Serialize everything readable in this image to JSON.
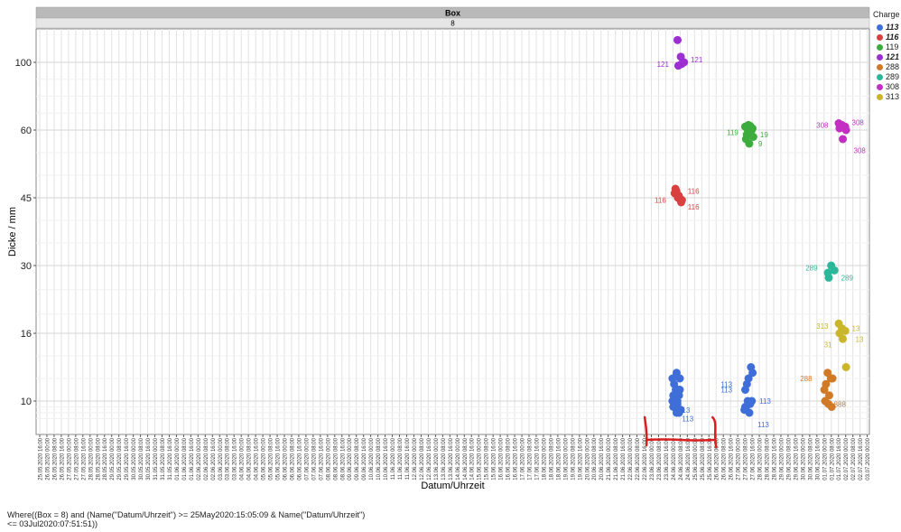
{
  "chart_data": {
    "type": "scatter",
    "panel_title": "Box",
    "panel_subtitle": "8",
    "xlabel": "Datum/Uhrzeit",
    "ylabel": "Dicke / mm",
    "y_tick_labels": [
      "10",
      "16",
      "30",
      "45",
      "60",
      "100"
    ],
    "x_tick_labels": [
      "25.05.2020 16:00",
      "26.05.2020 00:00",
      "26.05.2020 08:00",
      "26.05.2020 16:00",
      "27.05.2020 00:00",
      "27.05.2020 08:00",
      "27.05.2020 16:00",
      "28.05.2020 00:00",
      "28.05.2020 08:00",
      "28.05.2020 16:00",
      "29.05.2020 00:00",
      "29.05.2020 08:00",
      "29.05.2020 16:00",
      "30.05.2020 00:00",
      "30.05.2020 08:00",
      "30.05.2020 16:00",
      "31.05.2020 00:00",
      "31.05.2020 08:00",
      "31.05.2020 16:00",
      "01.06.2020 00:00",
      "01.06.2020 08:00",
      "01.06.2020 16:00",
      "02.06.2020 00:00",
      "02.06.2020 08:00",
      "02.06.2020 16:00",
      "03.06.2020 00:00",
      "03.06.2020 08:00",
      "03.06.2020 16:00",
      "04.06.2020 00:00",
      "04.06.2020 08:00",
      "04.06.2020 16:00",
      "05.06.2020 00:00",
      "05.06.2020 08:00",
      "05.06.2020 16:00",
      "06.06.2020 00:00",
      "06.06.2020 08:00",
      "06.06.2020 16:00",
      "07.06.2020 00:00",
      "07.06.2020 08:00",
      "07.06.2020 16:00",
      "08.06.2020 00:00",
      "08.06.2020 08:00",
      "08.06.2020 16:00",
      "09.06.2020 00:00",
      "09.06.2020 08:00",
      "09.06.2020 16:00",
      "10.06.2020 00:00",
      "10.06.2020 08:00",
      "10.06.2020 16:00",
      "11.06.2020 00:00",
      "11.06.2020 08:00",
      "11.06.2020 16:00",
      "12.06.2020 00:00",
      "12.06.2020 08:00",
      "12.06.2020 16:00",
      "13.06.2020 00:00",
      "13.06.2020 08:00",
      "13.06.2020 16:00",
      "14.06.2020 00:00",
      "14.06.2020 08:00",
      "14.06.2020 16:00",
      "15.06.2020 00:00",
      "15.06.2020 08:00",
      "15.06.2020 16:00",
      "16.06.2020 00:00",
      "16.06.2020 08:00",
      "16.06.2020 16:00",
      "17.06.2020 00:00",
      "17.06.2020 08:00",
      "17.06.2020 16:00",
      "18.06.2020 00:00",
      "18.06.2020 08:00",
      "18.06.2020 16:00",
      "19.06.2020 00:00",
      "19.06.2020 08:00",
      "19.06.2020 16:00",
      "20.06.2020 00:00",
      "20.06.2020 08:00",
      "20.06.2020 16:00",
      "21.06.2020 00:00",
      "21.06.2020 08:00",
      "21.06.2020 16:00",
      "22.06.2020 00:00",
      "22.06.2020 08:00",
      "22.06.2020 16:00",
      "23.06.2020 00:00",
      "23.06.2020 08:00",
      "23.06.2020 16:00",
      "24.06.2020 00:00",
      "24.06.2020 08:00",
      "24.06.2020 16:00",
      "25.06.2020 00:00",
      "25.06.2020 08:00",
      "25.06.2020 16:00",
      "26.06.2020 00:00",
      "26.06.2020 08:00",
      "26.06.2020 16:00",
      "27.06.2020 00:00",
      "27.06.2020 08:00",
      "27.06.2020 16:00",
      "28.06.2020 00:00",
      "28.06.2020 08:00",
      "28.06.2020 16:00",
      "29.06.2020 00:00",
      "29.06.2020 08:00",
      "29.06.2020 16:00",
      "30.06.2020 00:00",
      "30.06.2020 08:00",
      "30.06.2020 16:00",
      "01.07.2020 00:00",
      "01.07.2020 08:00",
      "01.07.2020 16:00",
      "02.07.2020 00:00",
      "02.07.2020 08:00",
      "02.07.2020 16:00",
      "03.07.2020 00:00"
    ],
    "grid": true,
    "legend_title": "Charge",
    "legend_placement": "right",
    "series": [
      {
        "name": "113",
        "color": "#3f6ed8",
        "bold_italic": true,
        "x_index": 88.5,
        "x_index_b": 98.5,
        "values": [
          10,
          11,
          10.5,
          9,
          8,
          12,
          11.5,
          9.5,
          8.5,
          10,
          11,
          12,
          9,
          8,
          10.5,
          12.5,
          11,
          9.5,
          10,
          8.5
        ],
        "values_b": [
          11,
          12,
          10,
          9,
          8,
          12.5,
          11.5,
          9.5,
          8.5,
          10,
          13,
          9
        ]
      },
      {
        "name": "116",
        "color": "#d94040",
        "bold_italic": true,
        "x_index": 88.8,
        "values": [
          46,
          45,
          44,
          47,
          45.5,
          44.5,
          46.5,
          45
        ]
      },
      {
        "name": "119",
        "color": "#3cad3c",
        "bold_italic": false,
        "x_index": 98.6,
        "values": [
          62,
          63,
          60,
          58,
          57,
          61,
          59,
          62.5,
          58.5,
          60.5
        ]
      },
      {
        "name": "121",
        "color": "#9b2fd0",
        "bold_italic": true,
        "x_index": 89.2,
        "values": [
          108,
          102,
          100,
          98,
          99
        ]
      },
      {
        "name": "288",
        "color": "#d07a28",
        "bold_italic": false,
        "x_index": 109.6,
        "values": [
          11,
          12.5,
          12,
          10,
          9.5,
          9,
          11.5,
          10.5,
          12
        ]
      },
      {
        "name": "289",
        "color": "#2bb89a",
        "bold_italic": false,
        "x_index": 110.1,
        "values": [
          28.5,
          30,
          29,
          27.5
        ]
      },
      {
        "name": "308",
        "color": "#c32fc3",
        "bold_italic": false,
        "x_index": 111.6,
        "values": [
          64,
          63,
          62,
          61,
          58,
          60
        ]
      },
      {
        "name": "313",
        "color": "#c9b62a",
        "bold_italic": false,
        "x_index": 111.6,
        "values": [
          18,
          17,
          16.5,
          16,
          15.5,
          13
        ]
      }
    ],
    "point_labels": [
      {
        "series": "121",
        "text": "121",
        "value": 101
      },
      {
        "series": "121",
        "text": "121",
        "value": 99
      },
      {
        "series": "116",
        "text": "116",
        "value": 46.5
      },
      {
        "series": "116",
        "text": "116",
        "value": 44.5
      },
      {
        "series": "116",
        "text": "116",
        "value": 43
      },
      {
        "series": "119",
        "text": "119",
        "value": 59.5
      },
      {
        "series": "119",
        "text": "19",
        "value": 59
      },
      {
        "series": "119",
        "text": "9",
        "value": 57
      },
      {
        "series": "289",
        "text": "289",
        "value": 29.5
      },
      {
        "series": "289",
        "text": "289",
        "value": 27.5
      },
      {
        "series": "308",
        "text": "308",
        "value": 63
      },
      {
        "series": "308",
        "text": "308",
        "value": 64.5
      },
      {
        "series": "308",
        "text": "308",
        "value": 55.5
      },
      {
        "series": "313",
        "text": "313",
        "value": 17.5
      },
      {
        "series": "313",
        "text": "13",
        "value": 17
      },
      {
        "series": "313",
        "text": "31",
        "value": 15
      },
      {
        "series": "313",
        "text": "13",
        "value": 15.5
      },
      {
        "series": "288",
        "text": "288",
        "value": 12
      },
      {
        "series": "288",
        "text": "888",
        "value": 9.5
      },
      {
        "series": "113",
        "text": "113",
        "value": 7
      },
      {
        "series": "113",
        "text": "13",
        "value": 8.5
      },
      {
        "series": "113",
        "text": "113",
        "value": 11.5
      },
      {
        "series": "113",
        "text": "113",
        "value": 11
      },
      {
        "series": "113",
        "text": "113",
        "value": 10
      },
      {
        "series": "113",
        "text": "113",
        "value": 6
      }
    ]
  },
  "filter_text": "Where((Box = 8) and (Name(\"Datum/Uhrzeit\") >= 25May2020:15:05:09 & Name(\"Datum/Uhrzeit\") <= 03Jul2020:07:51:51))"
}
